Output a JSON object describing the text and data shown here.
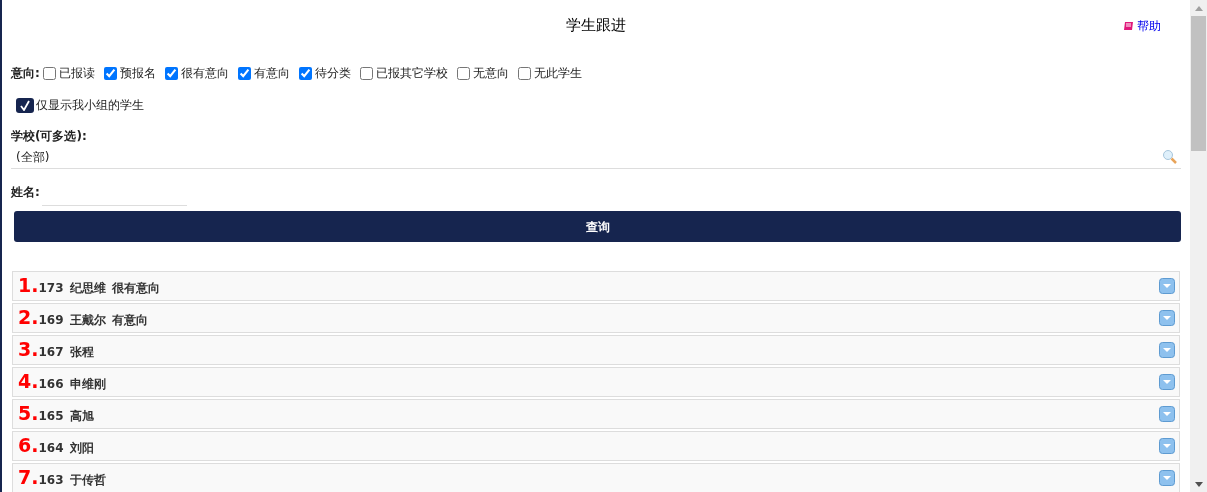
{
  "title": "学生跟进",
  "help_link": "帮助",
  "intent": {
    "label": "意向:",
    "options": [
      {
        "label": "已报读",
        "checked": false
      },
      {
        "label": "预报名",
        "checked": true
      },
      {
        "label": "很有意向",
        "checked": true
      },
      {
        "label": "有意向",
        "checked": true
      },
      {
        "label": "待分类",
        "checked": true
      },
      {
        "label": "已报其它学校",
        "checked": false
      },
      {
        "label": "无意向",
        "checked": false
      },
      {
        "label": "无此学生",
        "checked": false
      }
    ]
  },
  "my_group_only": {
    "label": "仅显示我小组的学生",
    "checked": true
  },
  "school": {
    "label": "学校(可多选):",
    "value": "(全部)"
  },
  "name": {
    "label": "姓名:"
  },
  "query_button": "查询",
  "students": [
    {
      "index": "1.",
      "score": "173",
      "name": "纪思维",
      "intent": "很有意向"
    },
    {
      "index": "2.",
      "score": "169",
      "name": "王戴尔",
      "intent": "有意向"
    },
    {
      "index": "3.",
      "score": "167",
      "name": "张程"
    },
    {
      "index": "4.",
      "score": "166",
      "name": "申维刚"
    },
    {
      "index": "5.",
      "score": "165",
      "name": "高旭"
    },
    {
      "index": "6.",
      "score": "164",
      "name": "刘阳"
    },
    {
      "index": "7.",
      "score": "163",
      "name": "于传哲"
    }
  ]
}
